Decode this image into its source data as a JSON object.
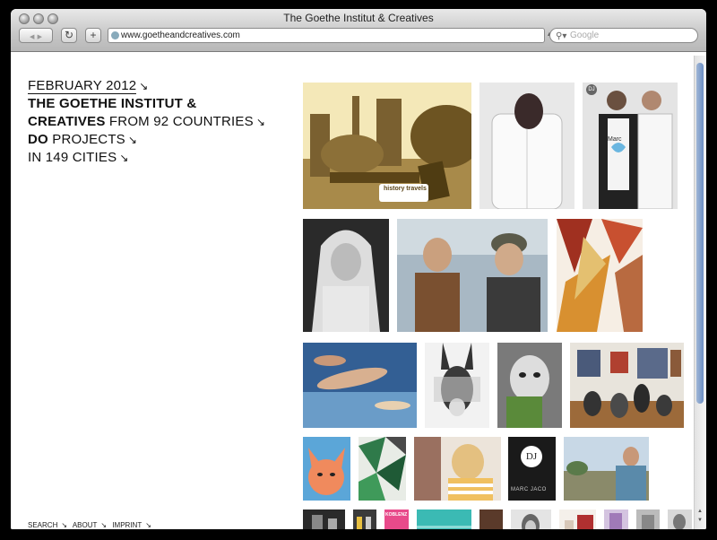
{
  "window": {
    "title": "The Goethe Institut & Creatives",
    "url": "www.goetheandcreatives.com",
    "search_placeholder": "Google",
    "reload_glyph": "↻",
    "add_glyph": "+",
    "back_glyph": "◀",
    "forward_glyph": "▶"
  },
  "headline": {
    "line1": "FEBRUARY 2012",
    "line2_bold": "THE GOETHE INSTITUT &",
    "line3_bold": "CREATIVES",
    "line3_rest": "FROM 92 COUNTRIES",
    "line4_bold": "DO",
    "line4_rest": "PROJECTS",
    "line5": "IN 149 CITIES",
    "arrow": "↘"
  },
  "footer": {
    "search": "SEARCH",
    "about": "ABOUT",
    "imprint": "IMPRINT",
    "arrow": "↘"
  },
  "tiles": {
    "history_label": "history travels",
    "marc_shirt": "Marc",
    "dj_logo": "DJ",
    "dj_book_logo": "DJ",
    "dj_book_caption": "MARC JACO",
    "koblenz_label": "KOBLENZ"
  },
  "colors": {
    "accent_scroll": "#6d8fc4",
    "sepia": "#c9a55a",
    "teal": "#37b6b1",
    "coral": "#f08a5d"
  }
}
